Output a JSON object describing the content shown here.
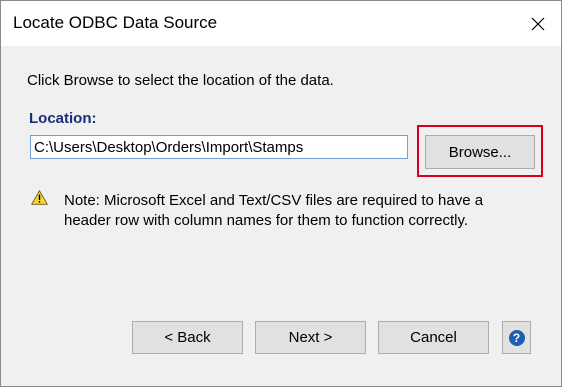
{
  "window": {
    "title": "Locate ODBC Data Source",
    "close_icon": "close-icon"
  },
  "main": {
    "intro_text": "Click Browse to select the location of the data.",
    "location_label": "Location:",
    "location_value": "C:\\Users\\Desktop\\Orders\\Import\\Stamps",
    "browse_label": "Browse...",
    "note_lines": [
      "Note: Microsoft Excel and Text/CSV files are required to have a",
      "header row with column names for them to function correctly."
    ],
    "warning_icon": "warning-icon"
  },
  "footer": {
    "back_label": "< Back",
    "next_label": "Next >",
    "cancel_label": "Cancel",
    "help_icon": "help-icon",
    "help_glyph": "?"
  },
  "colors": {
    "highlight": "#d6001c",
    "label_blue": "#1a2e7a",
    "help_blue": "#1c5fb0"
  }
}
